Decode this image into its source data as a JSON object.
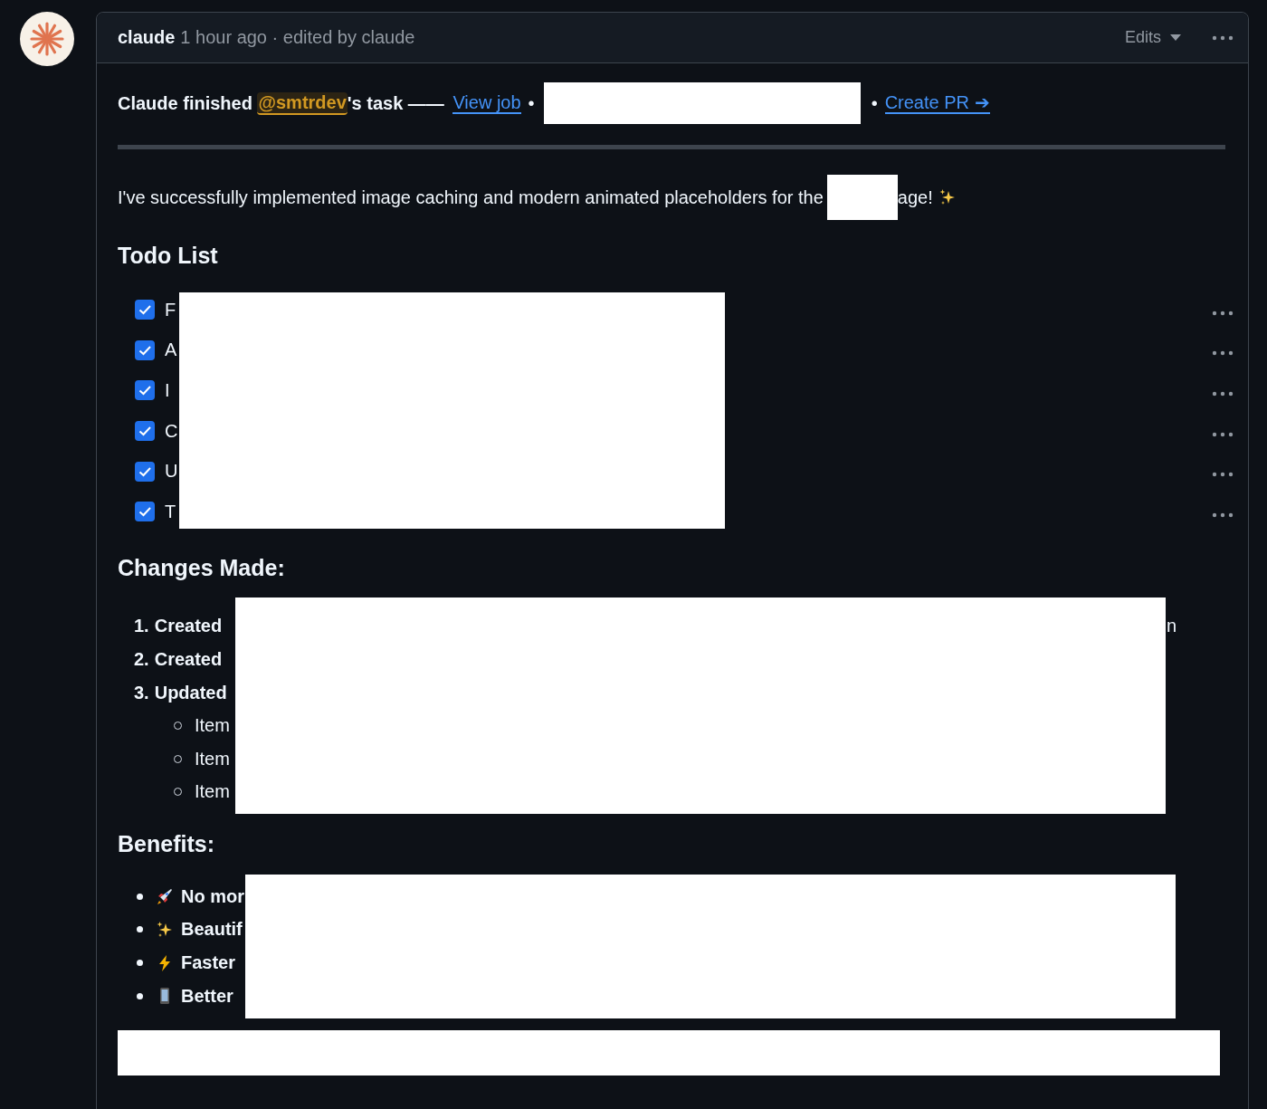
{
  "comment": {
    "author": "claude",
    "meta": "1 hour ago · edited by claude",
    "edits": "Edits"
  },
  "status_line": [
    {
      "kind": "text",
      "text": "Claude finished "
    },
    {
      "kind": "mention",
      "text": "@smtrdev"
    },
    {
      "kind": "text",
      "text": "'s task —— "
    },
    {
      "kind": "link",
      "text": "View job"
    },
    {
      "kind": "sep",
      "text": "•"
    },
    {
      "kind": "redaction"
    },
    {
      "kind": "sep",
      "text": "•"
    },
    {
      "kind": "link",
      "text": "Create PR ➔"
    }
  ],
  "intro": [
    {
      "kind": "text",
      "text": "I've successfully implemented image caching and modern animated placeholders for the"
    },
    {
      "kind": "redaction"
    },
    {
      "kind": "text",
      "text": "age!"
    },
    {
      "kind": "sparkle"
    }
  ],
  "todo": {
    "title": "Todo List",
    "items": [
      {
        "text": "F",
        "checked": true
      },
      {
        "text": "A",
        "checked": true
      },
      {
        "text": "I",
        "checked": true
      },
      {
        "text": "C",
        "checked": true
      },
      {
        "text": "U",
        "checked": true
      },
      {
        "text": "T",
        "checked": true
      }
    ]
  },
  "changes": {
    "title": "Changes Made:",
    "items": [
      {
        "number": "1.",
        "text": "Created",
        "tail": "n"
      },
      {
        "number": "2.",
        "text": "Created"
      },
      {
        "number": "3.",
        "text": "Updated",
        "children": [
          {
            "text": "Item"
          },
          {
            "text": "Item"
          },
          {
            "text": "Item"
          }
        ]
      }
    ]
  },
  "benefits": {
    "title": "Benefits:",
    "items": [
      {
        "kind": "rocket",
        "text": "No mor"
      },
      {
        "kind": "sparkle",
        "text": "Beautif"
      },
      {
        "kind": "lightning",
        "text": "Faster"
      },
      {
        "kind": "phone",
        "text": "Better"
      }
    ]
  }
}
